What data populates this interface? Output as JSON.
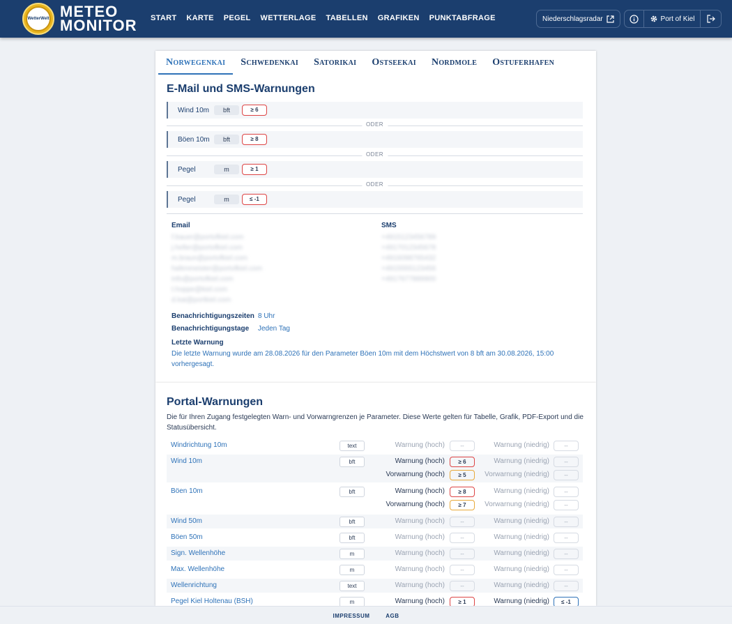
{
  "app": {
    "logo_line1": "METEO",
    "logo_line2": "MONITOR",
    "badge": "WetterWelt"
  },
  "nav": [
    "START",
    "KARTE",
    "PEGEL",
    "WETTERLAGE",
    "TABELLEN",
    "GRAFIKEN",
    "PUNKTABFRAGE"
  ],
  "toolbar": {
    "radar_label": "Niederschlagsradar",
    "port_label": "Port of Kiel"
  },
  "tabs": [
    "Norwegenkai",
    "Schwedenkai",
    "Satorikai",
    "Ostseekai",
    "Nordmole",
    "Ostuferhafen"
  ],
  "alerts": {
    "title": "E-Mail und SMS-Warnungen",
    "or_label": "ODER",
    "rules": [
      {
        "param": "Wind 10m",
        "unit": "bft",
        "value": "≥ 6"
      },
      {
        "param": "Böen 10m",
        "unit": "bft",
        "value": "≥ 8"
      },
      {
        "param": "Pegel",
        "unit": "m",
        "value": "≥ 1"
      },
      {
        "param": "Pegel",
        "unit": "m",
        "value": "≤ -1"
      }
    ],
    "email_label": "Email",
    "sms_label": "SMS",
    "emails": [
      "f.bauer@portofkiel.com",
      "j.heller@portofkiel.com",
      "m.braun@portofkiel.com",
      "hafenmeister@portofkiel.com",
      "info@portofkiel.com",
      "t.hoppe@kiel.com",
      "d.kai@portkiel.com"
    ],
    "phones": [
      "+4915123456789",
      "+4917012345678",
      "+4916098765432",
      "+4915555123456",
      "+4917677889900"
    ],
    "times_label": "Benachrichtigungszeiten",
    "times_value": "8 Uhr",
    "days_label": "Benachrichtigungstage",
    "days_value": "Jeden Tag",
    "last_label": "Letzte Warnung",
    "last_text": "Die letzte Warnung wurde am 28.08.2026 für den Parameter Böen 10m mit dem Höchstwert von 8 bft am 30.08.2026, 15:00",
    "last_text2": "vorhergesagt."
  },
  "portal": {
    "title": "Portal-Warnungen",
    "desc1": "Die für Ihren Zugang festgelegten Warn- und Vorwarngrenzen je Parameter. Diese Werte gelten für Tabelle, Grafik, PDF-Export und die",
    "desc2": "Statusübersicht.",
    "rows": [
      {
        "name": "Windrichtung 10m",
        "unit": "text",
        "lines": [
          {
            "hl": "Warnung (hoch)",
            "hv": "--",
            "ll": "Warnung (niedrig)",
            "lv": "--"
          }
        ]
      },
      {
        "name": "Wind 10m",
        "unit": "bft",
        "lines": [
          {
            "hl": "Warnung (hoch)",
            "hv": "≥ 6",
            "ll": "Warnung (niedrig)",
            "lv": "--"
          },
          {
            "hl": "Vorwarnung (hoch)",
            "hv": "≥ 5",
            "ll": "Vorwarnung (niedrig)",
            "lv": "--"
          }
        ]
      },
      {
        "name": "Böen 10m",
        "unit": "bft",
        "lines": [
          {
            "hl": "Warnung (hoch)",
            "hv": "≥ 8",
            "ll": "Warnung (niedrig)",
            "lv": "--"
          },
          {
            "hl": "Vorwarnung (hoch)",
            "hv": "≥ 7",
            "ll": "Vorwarnung (niedrig)",
            "lv": "--"
          }
        ]
      },
      {
        "name": "Wind 50m",
        "unit": "bft",
        "lines": [
          {
            "hl": "Warnung (hoch)",
            "hv": "--",
            "ll": "Warnung (niedrig)",
            "lv": "--"
          }
        ]
      },
      {
        "name": "Böen 50m",
        "unit": "bft",
        "lines": [
          {
            "hl": "Warnung (hoch)",
            "hv": "--",
            "ll": "Warnung (niedrig)",
            "lv": "--"
          }
        ]
      },
      {
        "name": "Sign. Wellenhöhe",
        "unit": "m",
        "lines": [
          {
            "hl": "Warnung (hoch)",
            "hv": "--",
            "ll": "Warnung (niedrig)",
            "lv": "--"
          }
        ]
      },
      {
        "name": "Max. Wellenhöhe",
        "unit": "m",
        "lines": [
          {
            "hl": "Warnung (hoch)",
            "hv": "--",
            "ll": "Warnung (niedrig)",
            "lv": "--"
          }
        ]
      },
      {
        "name": "Wellenrichtung",
        "unit": "text",
        "lines": [
          {
            "hl": "Warnung (hoch)",
            "hv": "--",
            "ll": "Warnung (niedrig)",
            "lv": "--"
          }
        ]
      },
      {
        "name": "Pegel Kiel Holtenau (BSH)",
        "unit": "m",
        "lines": [
          {
            "hl": "Warnung (hoch)",
            "hv": "≥ 1",
            "ll": "Warnung (niedrig)",
            "lv": "≤ -1"
          }
        ]
      }
    ]
  },
  "footer": {
    "impressum": "IMPRESSUM",
    "agb": "AGB"
  },
  "colors": {
    "header": "#1b3e6e",
    "accent": "#2e72b8",
    "warn": "#dd4444",
    "prewarn": "#e8a93a"
  }
}
